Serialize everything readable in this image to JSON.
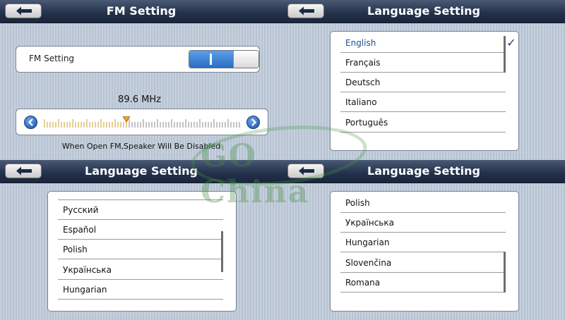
{
  "pane_fm": {
    "title": "FM Setting",
    "setting_label": "FM Setting",
    "toggle_state": "on",
    "frequency": "89.6 MHz",
    "hint": "When Open FM,Speaker Will Be Disabled"
  },
  "pane_lang1": {
    "title": "Language Setting",
    "items": [
      "English",
      "Français",
      "Deutsch",
      "Italiano",
      "Português"
    ],
    "selected": "English"
  },
  "pane_lang2": {
    "title": "Language Setting",
    "items": [
      "Русский",
      "Español",
      "Polish",
      "Українська",
      "Hungarian"
    ]
  },
  "pane_lang3": {
    "title": "Language Setting",
    "items": [
      "Polish",
      "Українська",
      "Hungarian",
      "Slovenčina",
      "Romana"
    ]
  },
  "watermark": {
    "text": "GO China"
  },
  "colors": {
    "titlebar": "#22304a",
    "accent": "#2a6cc4",
    "selected_text": "#1f4e9a"
  },
  "icons": {
    "back": "back-arrow-icon",
    "check": "checkmark-icon"
  }
}
